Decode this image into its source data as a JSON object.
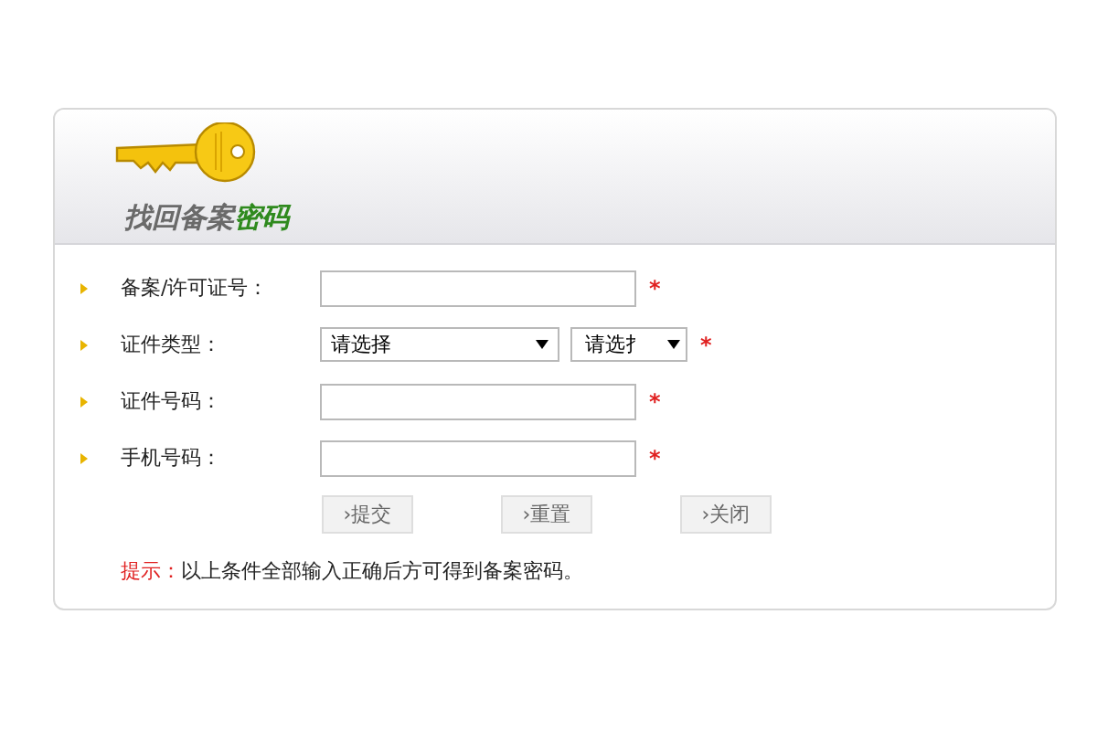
{
  "header": {
    "title": "找回备案",
    "title_accent": "密码"
  },
  "rows": [
    {
      "kind": "input",
      "label": "备案/许可证号：",
      "required_mark": "*"
    },
    {
      "kind": "select",
      "label": "证件类型：",
      "selects": [
        "请选择",
        "请选扌"
      ],
      "required_mark": "*"
    },
    {
      "kind": "input",
      "label": "证件号码：",
      "required_mark": "*"
    },
    {
      "kind": "input",
      "label": "手机号码：",
      "required_mark": "*"
    }
  ],
  "buttons": [
    "›提交",
    "›重置",
    "›关闭"
  ],
  "hint": {
    "prefix": "提示：",
    "text": "以上条件全部输入正确后方可得到备案密码。"
  }
}
